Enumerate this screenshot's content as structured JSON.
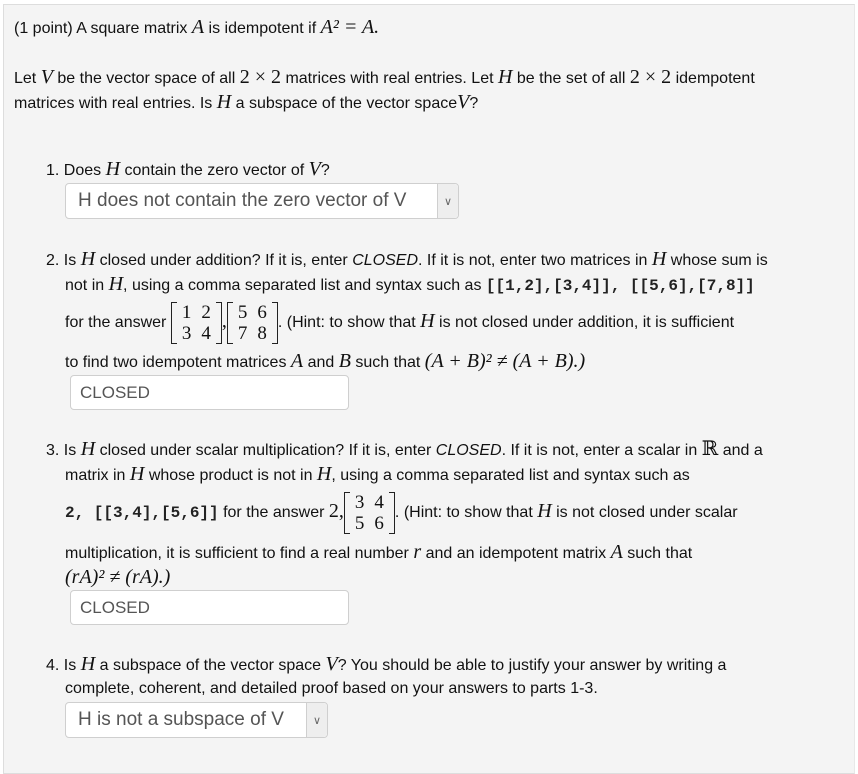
{
  "intro": {
    "points": "(1 point)",
    "sentence_start": "A square matrix",
    "var_A": "A",
    "is_idempotent_if": "is idempotent if",
    "equation": "A² = A.",
    "para2_line1_a": "Let",
    "var_V": "V",
    "para2_line1_b": "be the vector space of all",
    "dim": "2 × 2",
    "para2_line1_c": "matrices with real entries. Let",
    "var_H": "H",
    "para2_line1_d": "be the set of all",
    "para2_line1_e": "idempotent",
    "para2_line2_a": "matrices with real entries. Is",
    "para2_line2_b": "a subspace of the vector space",
    "para2_line2_c": "?"
  },
  "q1": {
    "number": "1.",
    "text_a": "Does",
    "text_b": "contain the zero vector of",
    "text_c": "?",
    "select_value": "H does not contain the zero vector of V"
  },
  "q2": {
    "number": "2.",
    "l1_a": "Is",
    "l1_b": "closed under addition? If it is, enter",
    "l1_closed": "CLOSED",
    "l1_c": ". If it is not, enter two matrices in",
    "l1_d": "whose sum is",
    "l2_a": "not in",
    "l2_b": ", using a comma separated list and syntax such as",
    "l2_code": "[[1,2],[3,4]], [[5,6],[7,8]]",
    "l3_a": "for the answer",
    "matrix1": [
      [
        "1",
        "2"
      ],
      [
        "3",
        "4"
      ]
    ],
    "matrix2": [
      [
        "5",
        "6"
      ],
      [
        "7",
        "8"
      ]
    ],
    "l3_b": ". (Hint: to show that",
    "l3_c": "is not closed under addition, it is sufficient",
    "l4_a": "to find two idempotent matrices",
    "l4_A": "A",
    "l4_and": "and",
    "l4_B": "B",
    "l4_b": "such that",
    "l4_eq": "(A + B)² ≠ (A + B).)",
    "input_value": "CLOSED"
  },
  "q3": {
    "number": "3.",
    "l1_a": "Is",
    "l1_b": "closed under scalar multiplication? If it is, enter",
    "l1_closed": "CLOSED",
    "l1_c": ". If it is not, enter a scalar in",
    "l1_R": "ℝ",
    "l1_d": "and a",
    "l2_a": "matrix in",
    "l2_b": "whose product is not in",
    "l2_c": ", using a comma separated list and syntax such as",
    "l3_code": "2, [[3,4],[5,6]]",
    "l3_a": "for the answer",
    "l3_two": "2,",
    "matrix": [
      [
        "3",
        "4"
      ],
      [
        "5",
        "6"
      ]
    ],
    "l3_b": ". (Hint: to show that",
    "l3_c": "is not closed under scalar",
    "l4_a": "multiplication, it is sufficient to find a real number",
    "l4_r": "r",
    "l4_b": "and an idempotent matrix",
    "l4_A": "A",
    "l4_c": "such that",
    "l5_eq": "(rA)² ≠ (rA).)",
    "input_value": "CLOSED"
  },
  "q4": {
    "number": "4.",
    "l1_a": "Is",
    "l1_b": "a subspace of the vector space",
    "l1_c": "? You should be able to justify your answer by writing a",
    "l2": "complete, coherent, and detailed proof based on your answers to parts 1-3.",
    "select_value": "H is not a subspace of V"
  },
  "icons": {
    "dropdown": "chevron-down-icon"
  }
}
